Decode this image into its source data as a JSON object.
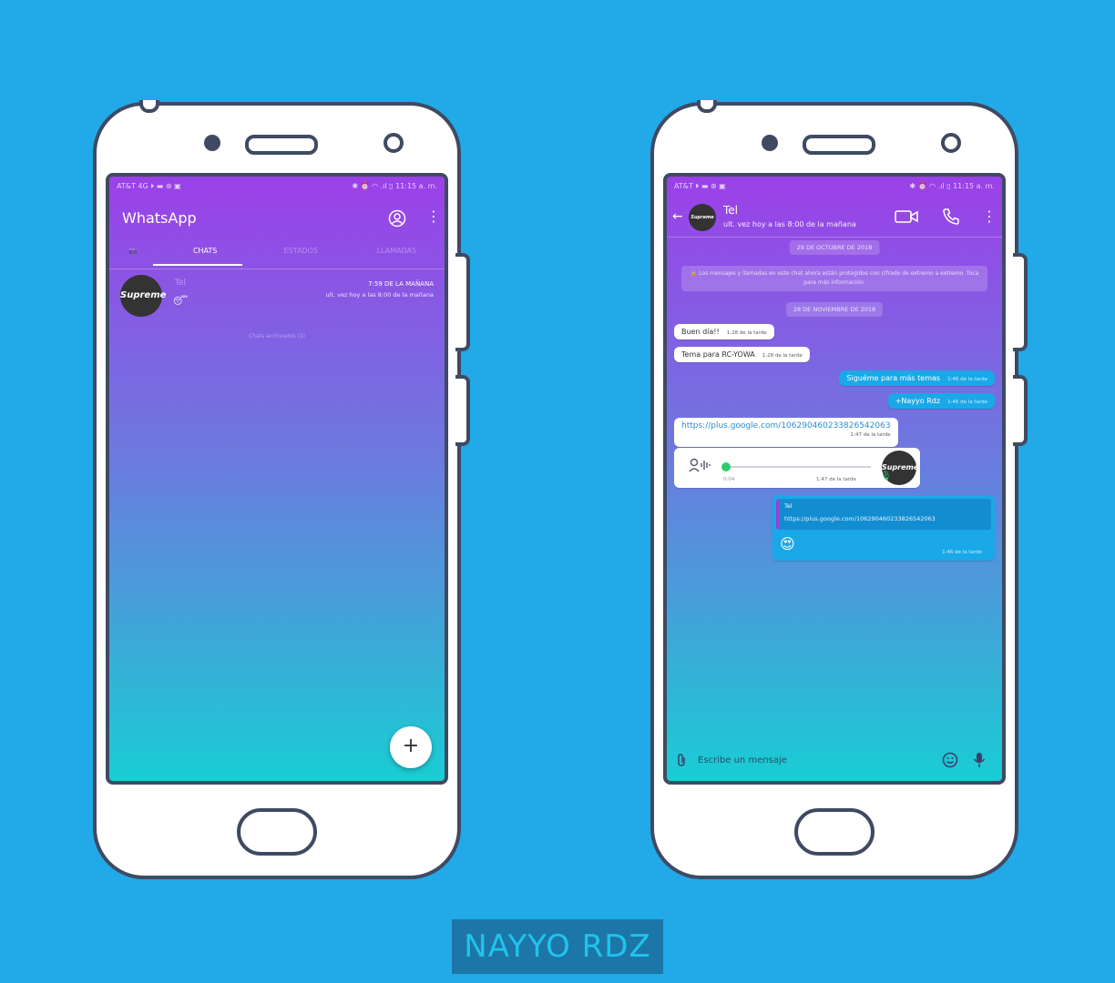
{
  "left_phone": {
    "status": {
      "left": "AT&T 4G ⏵ ▬ ⊛ ▣",
      "right": "✱ ⏰ ◠ .ıl ▯ 11:15 a. m."
    },
    "app_title": "WhatsApp",
    "tabs": [
      "📷",
      "CHATS",
      "ESTADOS",
      "LLAMADAS"
    ],
    "chat": {
      "avatar_text": "Supreme",
      "name": "Tel",
      "time": "7:59 DE LA MAÑANA",
      "subtitle": "ult. vez hoy a las 8:00 de la mañana",
      "preview_emoji": "😴"
    },
    "archived": "Chats archivados (1)",
    "fab_label": "+"
  },
  "right_phone": {
    "status": {
      "left": "AT&T ⏵ ▬ ⊛ ▣",
      "right": "✱ ⏰ ◠ .ıl ▯ 11:15 a. m."
    },
    "contact": {
      "name": "Tel",
      "last_seen": "ult. vez hoy a las 8:00 de la mañana",
      "avatar_text": "Supreme"
    },
    "date1": "29 DE OCTUBRE DE 2018",
    "encryption": "🔒 Los mensajes y llamadas en este chat ahora están protegidos con cifrado de extremo a extremo. Toca para más información.",
    "date2": "28 DE NOVIEMBRE DE 2018",
    "messages": [
      {
        "text": "Buen día!!",
        "time": "1:28 de la tarde"
      },
      {
        "text": "Tema para RC-YOWA",
        "time": "1:28 de la tarde"
      },
      {
        "text": "Siguéme para más temas",
        "time": "1:46 de la tarde"
      },
      {
        "text": "+Nayyo Rdz",
        "time": "1:46 de la tarde"
      },
      {
        "text": "https://plus.google.com/106290460233826542063",
        "time": "1:47 de la tarde"
      }
    ],
    "audio": {
      "duration": "0:04",
      "time": "1:47 de la tarde",
      "avatar_text": "Supreme"
    },
    "quote": {
      "author": "Tel",
      "text": "https://plus.google.com/106290460233826542063"
    },
    "reply": {
      "emoji": "😍",
      "time": "1:46 de la tarde"
    },
    "input_placeholder": "Escribe un mensaje"
  },
  "brand": "NAYYO RDZ"
}
